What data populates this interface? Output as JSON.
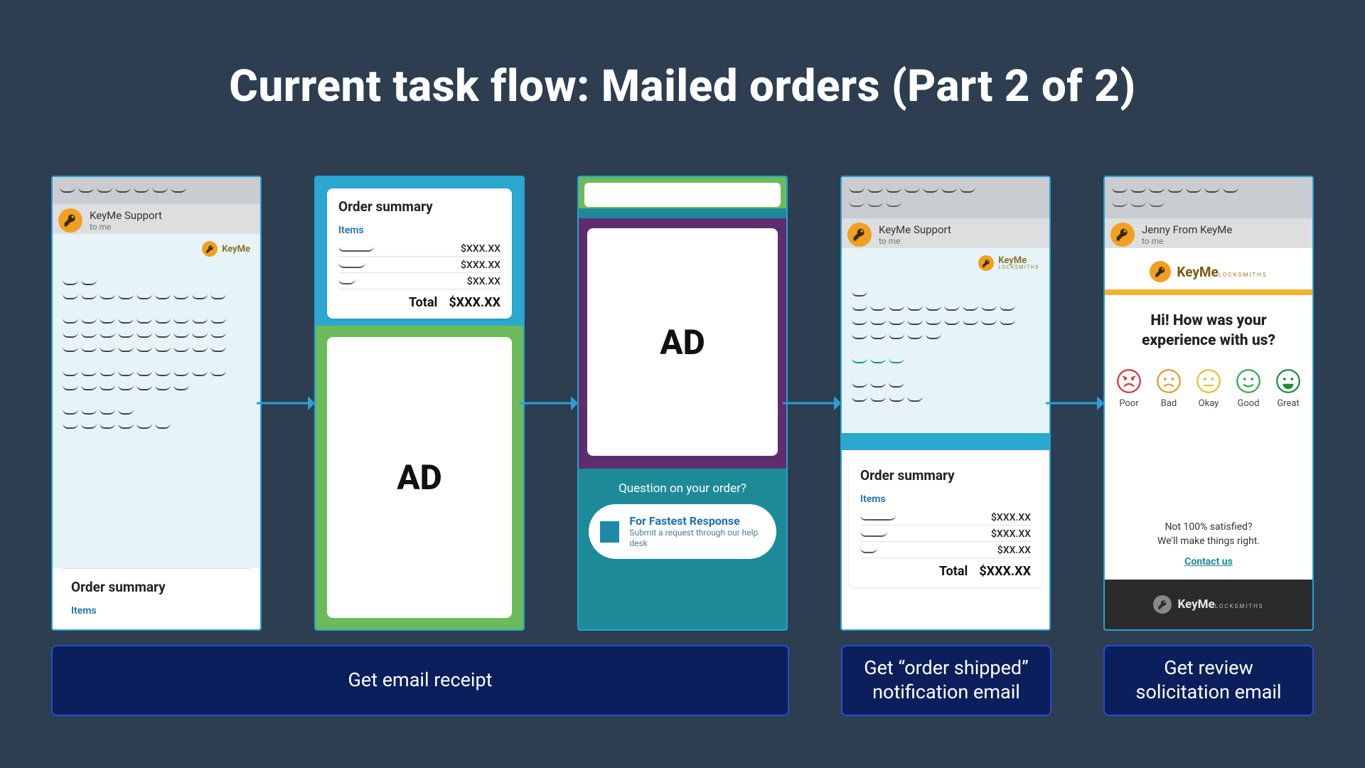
{
  "title": "Current task flow: Mailed orders (Part 2 of 2)",
  "brand": {
    "name": "KeyMe",
    "sub": "LOCKSMITHS"
  },
  "sender_support": {
    "name": "KeyMe Support",
    "to": "to me"
  },
  "sender_jenny": {
    "name": "Jenny From KeyMe",
    "to": "to me"
  },
  "order_summary": {
    "heading": "Order summary",
    "items_label": "Items",
    "amount": "$XXX.XX",
    "sub_amount": "$XX.XX",
    "total_label": "Total",
    "total_value": "$XXX.XX"
  },
  "ad_text": "AD",
  "help": {
    "question": "Question on your order?",
    "cta_title": "For Fastest Response",
    "cta_sub": "Submit a request through our help desk"
  },
  "survey": {
    "heading": "Hi! How was your experience with us?",
    "faces": [
      "Poor",
      "Bad",
      "Okay",
      "Good",
      "Great"
    ],
    "satisfy1": "Not 100% satisfied?",
    "satisfy2": "We'll make things right.",
    "contact": "Contact us"
  },
  "labels": {
    "receipt": "Get email receipt",
    "shipped": "Get “order shipped” notification email",
    "review": "Get review solicitation email"
  }
}
